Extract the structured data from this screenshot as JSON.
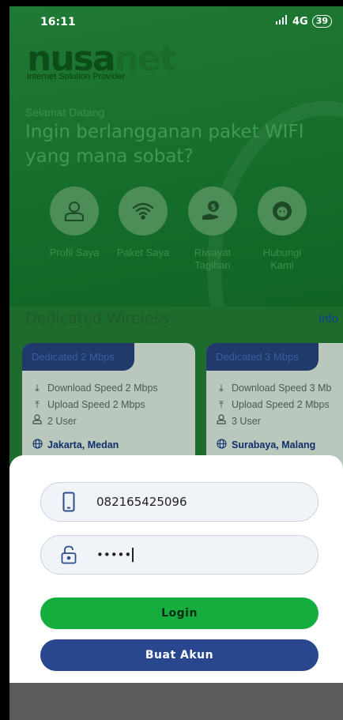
{
  "status_bar": {
    "time": "16:11",
    "network": "4G",
    "battery": "39"
  },
  "brand": {
    "logo_part1": "nusa",
    "logo_part2": "net",
    "tagline": "Internet Solution Provider"
  },
  "hero": {
    "greeting": "Selamat Datang",
    "headline": "Ingin berlangganan paket WIFI yang mana sobat?"
  },
  "menu": [
    {
      "label": "Profil Saya",
      "icon": "person-icon"
    },
    {
      "label": "Paket Saya",
      "icon": "wifi-icon"
    },
    {
      "label": "Riwayat Tagihan",
      "icon": "payment-icon"
    },
    {
      "label": "Hubungi Kami",
      "icon": "headset-icon"
    }
  ],
  "section": {
    "title": "Dedicated Wireless",
    "info_link": "Info"
  },
  "cards": [
    {
      "badge": "Dedicated 2 Mbps",
      "download": "Download Speed 2 Mbps",
      "upload": "Upload Speed 2 Mbps",
      "users": "2 User",
      "cities": "Jakarta, Medan"
    },
    {
      "badge": "Dedicated 3 Mbps",
      "download": "Download Speed 3 Mb",
      "upload": "Upload Speed 2 Mbps",
      "users": "3 User",
      "cities": "Surabaya, Malang"
    }
  ],
  "login_form": {
    "phone_value": "082165425096",
    "password_value": "•••••",
    "login_label": "Login",
    "create_account_label": "Buat Akun"
  },
  "colors": {
    "login_button": "#16ad3f",
    "create_button": "#28478f",
    "background_green": "#146b2a"
  }
}
